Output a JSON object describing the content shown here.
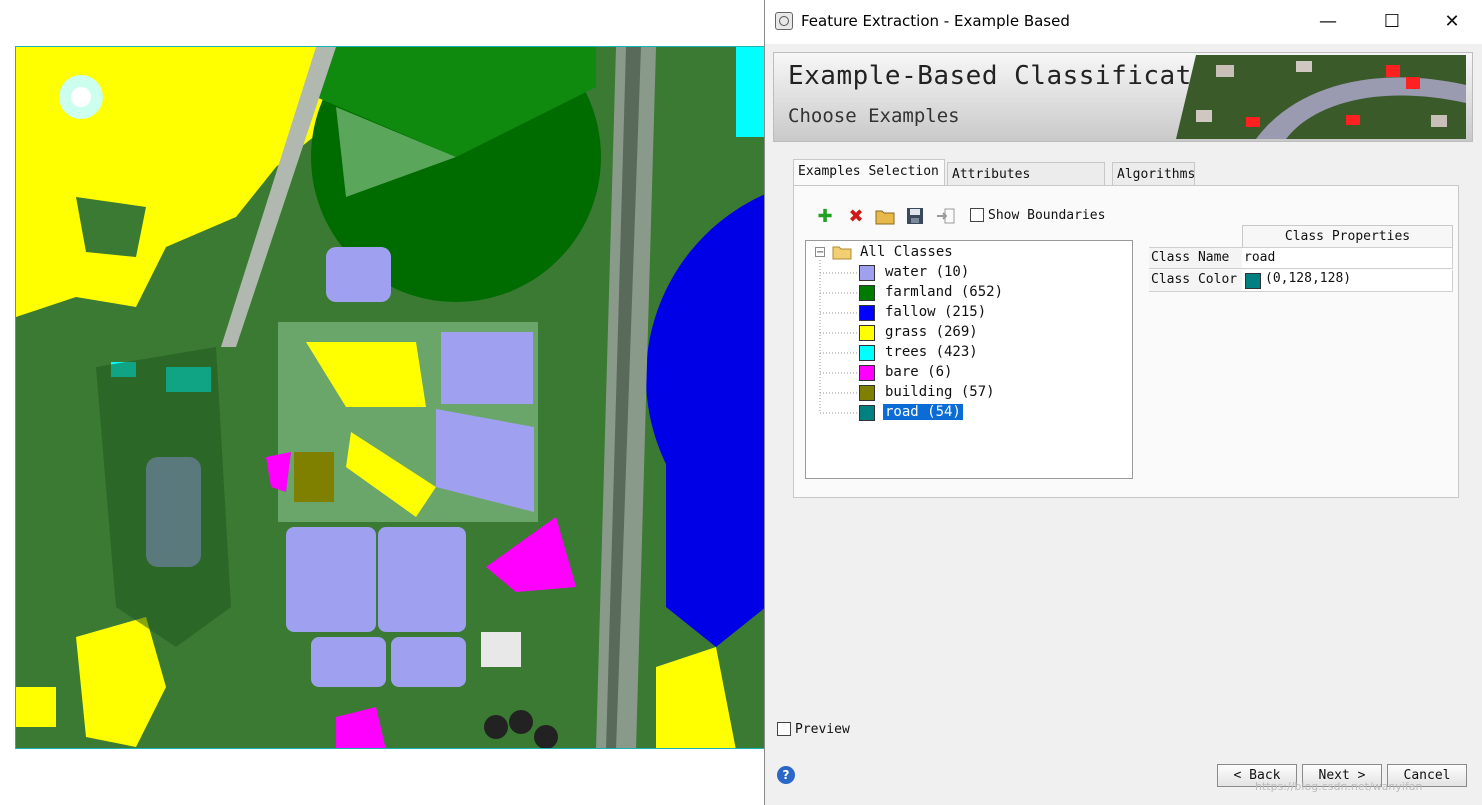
{
  "window": {
    "title": "Feature Extraction - Example Based",
    "minimize": "—",
    "maximize": "☐",
    "close": "✕"
  },
  "banner": {
    "title": "Example-Based Classification",
    "subtitle": "Choose Examples"
  },
  "tabs": [
    {
      "label": "Examples Selection",
      "active": true
    },
    {
      "label": "Attributes Selection",
      "active": false
    },
    {
      "label": "Algorithms",
      "active": false
    }
  ],
  "toolbar": {
    "icons": [
      "add-icon",
      "delete-icon",
      "open-folder-icon",
      "save-icon",
      "import-icon"
    ],
    "show_boundaries_label": "Show Boundaries",
    "show_boundaries_checked": false
  },
  "tree": {
    "root_label": "All Classes",
    "classes": [
      {
        "label": "water (10)",
        "color": "#a0a0f0"
      },
      {
        "label": "farmland (652)",
        "color": "#007a00"
      },
      {
        "label": "fallow (215)",
        "color": "#0000ff"
      },
      {
        "label": "grass (269)",
        "color": "#ffff00"
      },
      {
        "label": "trees (423)",
        "color": "#00ffff"
      },
      {
        "label": "bare (6)",
        "color": "#ff00ff"
      },
      {
        "label": "building (57)",
        "color": "#808000"
      },
      {
        "label": "road (54)",
        "color": "#008080",
        "selected": true
      }
    ]
  },
  "properties": {
    "header": "Class Properties",
    "class_name_label": "Class Name",
    "class_name_value": "road",
    "class_color_label": "Class Color",
    "class_color_value": "(0,128,128)",
    "class_color_swatch": "#008080"
  },
  "preview": {
    "label": "Preview",
    "checked": false
  },
  "buttons": {
    "back": "< Back",
    "next": "Next >",
    "cancel": "Cancel"
  },
  "watermark": "https://blog.csdn.net/wanyifan"
}
